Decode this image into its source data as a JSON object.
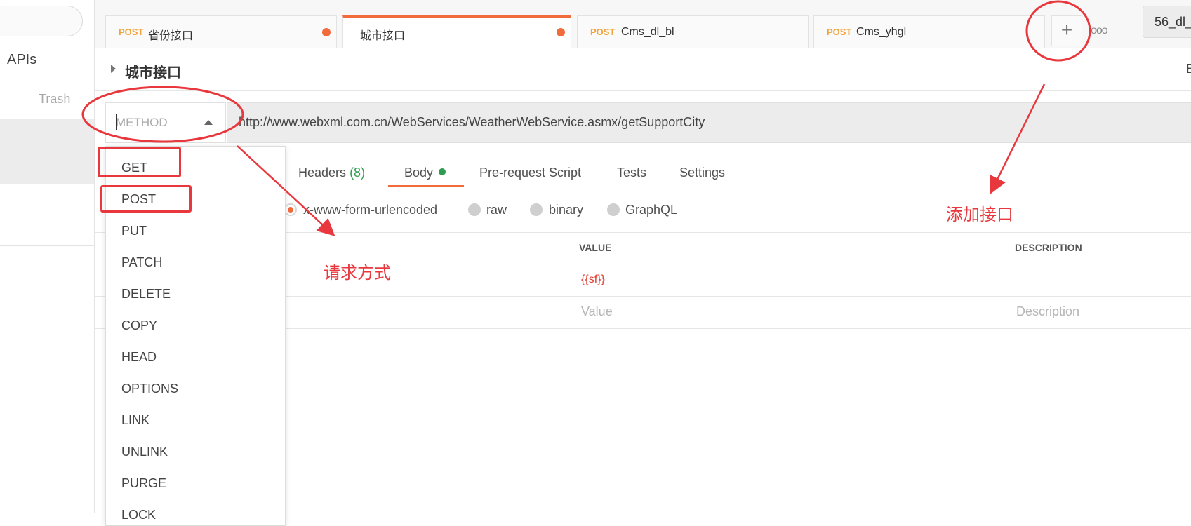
{
  "sidebar": {
    "apis_label": "APIs",
    "trash_label": "Trash"
  },
  "tabs": [
    {
      "method": "POST",
      "name": "省份接口",
      "unsaved": true
    },
    {
      "method": "",
      "name": "城市接口",
      "unsaved": true,
      "active": true
    },
    {
      "method": "POST",
      "name": "Cms_dl_bl",
      "unsaved": false
    },
    {
      "method": "POST",
      "name": "Cms_yhgl",
      "unsaved": false
    }
  ],
  "tabbar": {
    "new_tab_icon": "+",
    "more_icon": "ooo",
    "environment": "56_dl_"
  },
  "request": {
    "title": "城市接口",
    "edge_text": "E",
    "method_placeholder": "METHOD",
    "url": "http://www.webxml.com.cn/WebServices/WeatherWebService.asmx/getSupportCity"
  },
  "subtabs": {
    "headers_label": "Headers",
    "headers_count": "(8)",
    "body_label": "Body",
    "prerequest_label": "Pre-request Script",
    "tests_label": "Tests",
    "settings_label": "Settings"
  },
  "body_types": {
    "urlencoded": "x-www-form-urlencoded",
    "raw": "raw",
    "binary": "binary",
    "graphql": "GraphQL"
  },
  "table": {
    "value_header": "VALUE",
    "description_header": "DESCRIPTION",
    "row1_value": "{{sf}}",
    "value_placeholder": "Value",
    "description_placeholder": "Description"
  },
  "method_options": [
    "GET",
    "POST",
    "PUT",
    "PATCH",
    "DELETE",
    "COPY",
    "HEAD",
    "OPTIONS",
    "LINK",
    "UNLINK",
    "PURGE",
    "LOCK"
  ],
  "annotations": {
    "request_method": "请求方式",
    "add_api": "添加接口"
  },
  "colors": {
    "accent": "#f26b3a",
    "post_method": "#f0a33b",
    "annotation_red": "#e8383d",
    "success_green": "#2f9d4f"
  }
}
